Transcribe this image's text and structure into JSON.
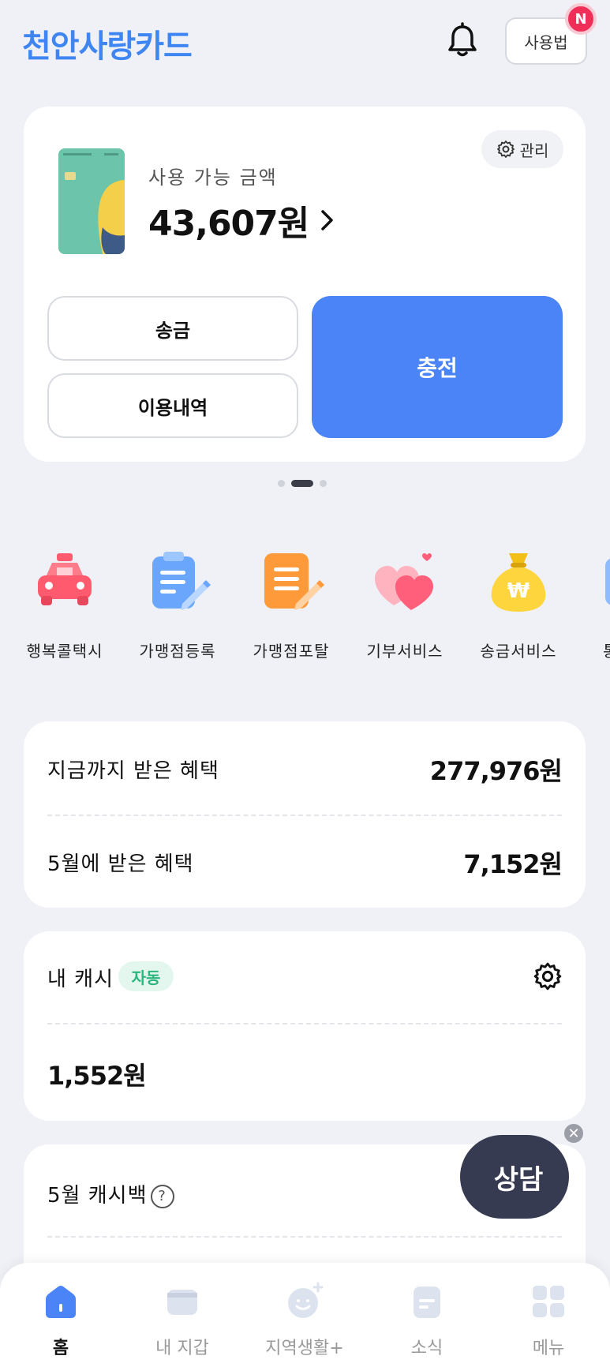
{
  "header": {
    "title": "천안사랑카드",
    "howto_label": "사용법",
    "new_badge": "N"
  },
  "balance_card": {
    "manage_label": "관리",
    "available_label": "사용 가능 금액",
    "amount": "43,607원",
    "send_label": "송금",
    "history_label": "이용내역",
    "charge_label": "충전",
    "accent_color": "#4a84f7"
  },
  "pager": {
    "total": 3,
    "active": 2
  },
  "quick_menu": [
    {
      "label": "행복콜택시",
      "icon": "taxi-icon"
    },
    {
      "label": "가맹점등록",
      "icon": "clipboard-icon"
    },
    {
      "label": "가맹점포탈",
      "icon": "document-icon"
    },
    {
      "label": "기부서비스",
      "icon": "hearts-icon"
    },
    {
      "label": "송금서비스",
      "icon": "money-bag-icon"
    },
    {
      "label": "통",
      "icon": "partial-icon"
    }
  ],
  "benefits": {
    "total_label": "지금까지 받은 혜택",
    "total_value": "277,976원",
    "month_label": "5월에 받은 혜택",
    "month_value": "7,152원"
  },
  "cash": {
    "label": "내 캐시",
    "auto_badge": "자동",
    "amount": "1,552원"
  },
  "cashback": {
    "label": "5월 캐시백",
    "help": "?"
  },
  "fab": {
    "label": "상담",
    "close": "✕"
  },
  "bottom_nav": [
    {
      "label": "홈",
      "icon": "home-icon",
      "active": true
    },
    {
      "label": "내 지갑",
      "icon": "wallet-icon",
      "active": false
    },
    {
      "label": "지역생활+",
      "icon": "smile-icon",
      "active": false
    },
    {
      "label": "소식",
      "icon": "news-icon",
      "active": false
    },
    {
      "label": "메뉴",
      "icon": "grid-icon",
      "active": false
    }
  ]
}
